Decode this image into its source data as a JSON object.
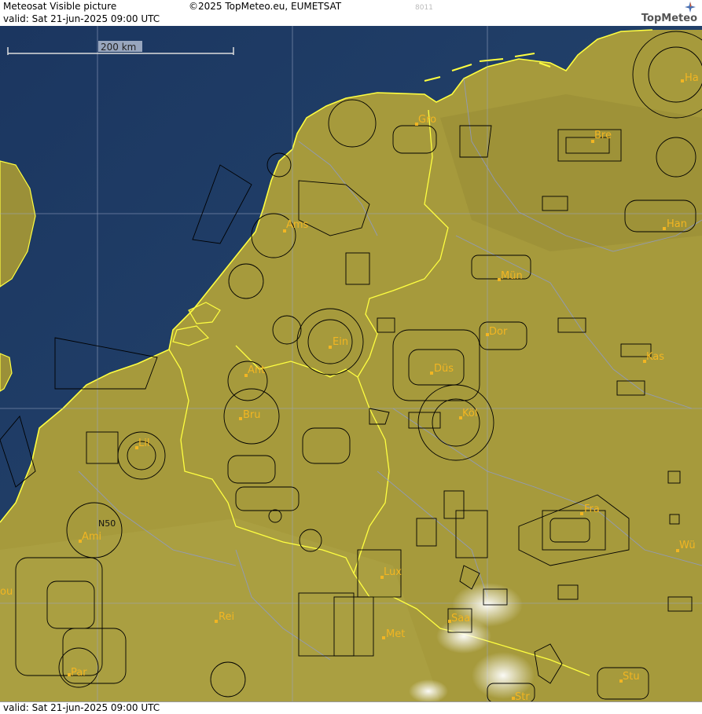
{
  "header": {
    "title": "Meteosat Visible picture",
    "valid": "valid:  Sat  21-jun-2025  09:00 UTC",
    "copyright": "©2025 TopMeteo.eu, EUMETSAT",
    "image_code": "8011",
    "logo": "TopMeteo"
  },
  "footer": {
    "valid": "valid:  Sat  21-jun-2025  09:00 UTC"
  },
  "scale": {
    "label": "200 km"
  },
  "airspace_label": "N50",
  "cities": [
    {
      "name": "Gro"
    },
    {
      "name": "Bre"
    },
    {
      "name": "Ha"
    },
    {
      "name": "Ams"
    },
    {
      "name": "Han"
    },
    {
      "name": "Mün"
    },
    {
      "name": "Ein"
    },
    {
      "name": "Dor"
    },
    {
      "name": "Kas"
    },
    {
      "name": "Ant"
    },
    {
      "name": "Düs"
    },
    {
      "name": "Bru"
    },
    {
      "name": "Köl"
    },
    {
      "name": "Lil"
    },
    {
      "name": "Fra"
    },
    {
      "name": "Ami"
    },
    {
      "name": "Wü"
    },
    {
      "name": "Lux"
    },
    {
      "name": "Rei"
    },
    {
      "name": "Saa"
    },
    {
      "name": "Met"
    },
    {
      "name": "Par"
    },
    {
      "name": "Stu"
    },
    {
      "name": "Str"
    },
    {
      "name": "ou"
    }
  ],
  "colors": {
    "sea": "#1f3d66",
    "land": "#a69a3c",
    "coast": "#ffff40",
    "border": "#8c9ad8",
    "airspace": "#000000",
    "city": "#f2b522"
  }
}
